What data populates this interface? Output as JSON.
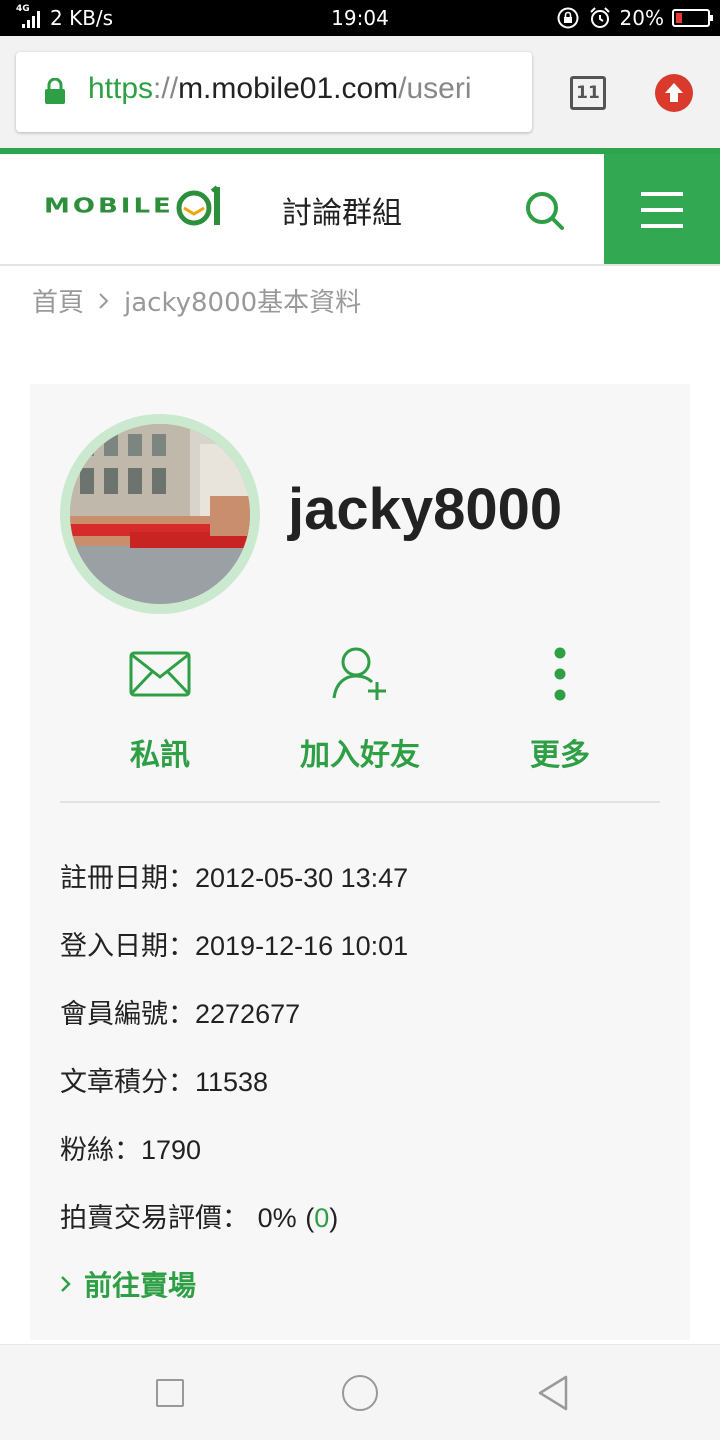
{
  "status_bar": {
    "network": "4G",
    "speed": "2 KB/s",
    "time": "19:04",
    "battery": "20%",
    "battery_level": 0.2,
    "icons": [
      "signal-icon",
      "lock-rotation-icon",
      "alarm-icon",
      "battery-icon"
    ]
  },
  "browser": {
    "url_scheme": "https",
    "url_sep": "://",
    "url_host": "m.mobile01.com",
    "url_path": "/useri",
    "tab_count": "11",
    "icons": [
      "lock-icon",
      "tabs-icon",
      "update-icon"
    ]
  },
  "site_header": {
    "logo_text": "MOBILE",
    "title": "討論群組",
    "icons": [
      "search-icon",
      "menu-icon"
    ],
    "colors": {
      "brand_green": "#2ea44f"
    }
  },
  "breadcrumb": {
    "home": "首頁",
    "current": "jacky8000基本資料"
  },
  "profile": {
    "username": "jacky8000",
    "actions": [
      {
        "label": "私訊",
        "icon": "mail-icon"
      },
      {
        "label": "加入好友",
        "icon": "add-friend-icon"
      },
      {
        "label": "更多",
        "icon": "more-vertical-icon"
      }
    ],
    "info": [
      {
        "label": "註冊日期：",
        "value": "2012-05-30 13:47"
      },
      {
        "label": "登入日期：",
        "value": "2019-12-16 10:01"
      },
      {
        "label": "會員編號：",
        "value": "2272677"
      },
      {
        "label": "文章積分：",
        "value": "11538"
      },
      {
        "label": "粉絲：",
        "value": "1790"
      }
    ],
    "rating": {
      "label": "拍賣交易評價：",
      "percent": "0%",
      "count": "0"
    },
    "shop_link": "前往賣場"
  },
  "nav_bar": {
    "icons": [
      "recents-icon",
      "home-icon",
      "back-icon"
    ]
  }
}
